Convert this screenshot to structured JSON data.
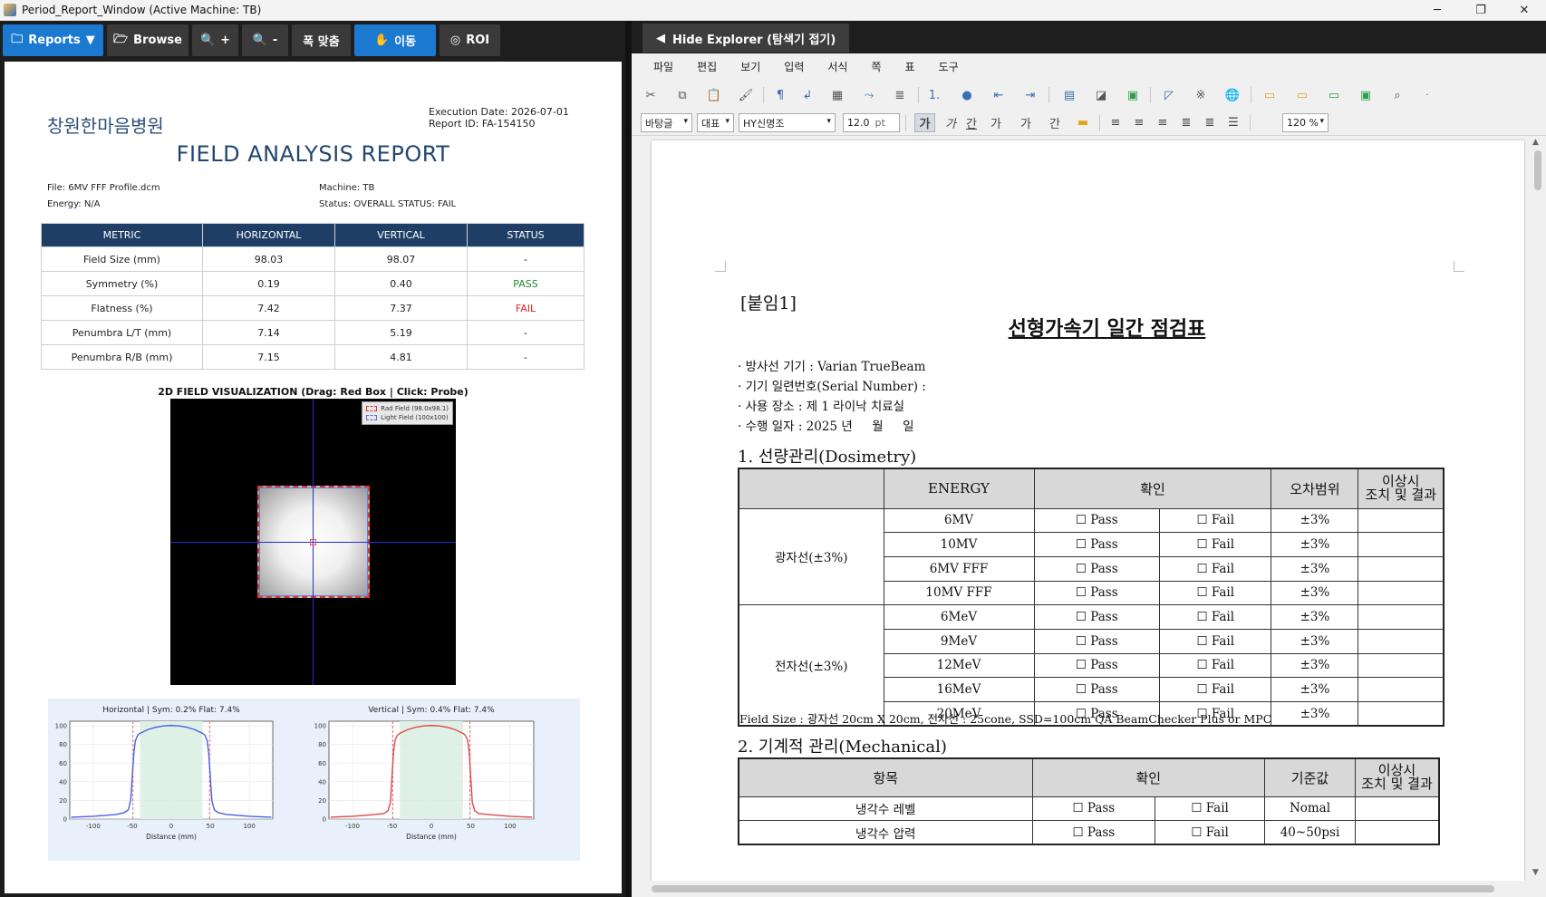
{
  "window": {
    "title": "Period_Report_Window (Active Machine: TB)",
    "minimize": "─",
    "maximize": "❐",
    "close": "✕"
  },
  "left_toolbar": {
    "reports": "Reports",
    "browse": "Browse",
    "zoom_in": "+",
    "zoom_out": "-",
    "fit_width": "폭 맞춤",
    "move": "이동",
    "roi": "ROI"
  },
  "report": {
    "hospital": "창원한마음병원",
    "execution_date": "Execution Date: 2026-07-01",
    "report_id": "Report ID: FA-154150",
    "title": "FIELD ANALYSIS REPORT",
    "file": "File: 6MV FFF Profile.dcm",
    "energy": "Energy: N/A",
    "machine": "Machine: TB",
    "status": "Status: OVERALL STATUS: FAIL",
    "table": {
      "headers": [
        "METRIC",
        "HORIZONTAL",
        "VERTICAL",
        "STATUS"
      ],
      "rows": [
        [
          "Field Size (mm)",
          "98.03",
          "98.07",
          "-"
        ],
        [
          "Symmetry (%)",
          "0.19",
          "0.40",
          "PASS"
        ],
        [
          "Flatness (%)",
          "7.42",
          "7.37",
          "FAIL"
        ],
        [
          "Penumbra L/T (mm)",
          "7.14",
          "5.19",
          "-"
        ],
        [
          "Penumbra R/B (mm)",
          "7.15",
          "4.81",
          "-"
        ]
      ]
    },
    "viz_title": "2D FIELD VISUALIZATION (Drag: Red Box | Click: Probe)",
    "viz_legend": [
      "Rad Field (98.0x98.1)",
      "Light Field (100x100)"
    ],
    "colors": {
      "header": "#1f3e66",
      "pass": "#1d8a2f",
      "fail": "#e02121",
      "horizontal": "#4a5ee8",
      "vertical": "#e04848"
    }
  },
  "chart_data": [
    {
      "type": "line",
      "title": "Horizontal | Sym: 0.2% Flat: 7.4%",
      "xlabel": "Distance (mm)",
      "ylabel": "",
      "xlim": [
        -130,
        130
      ],
      "ylim": [
        0,
        105
      ],
      "xticks": [
        -100,
        -50,
        0,
        50,
        100
      ],
      "yticks": [
        0,
        20,
        40,
        60,
        80,
        100
      ],
      "field_edges": [
        -49,
        49
      ],
      "flat_region": [
        -40,
        40
      ],
      "x": [
        -128,
        -100,
        -70,
        -60,
        -55,
        -52,
        -50,
        -48,
        -46,
        -43,
        -40,
        -30,
        -20,
        -10,
        0,
        10,
        20,
        30,
        40,
        43,
        46,
        48,
        50,
        52,
        55,
        60,
        70,
        100,
        128
      ],
      "y": [
        2,
        3,
        5,
        7,
        10,
        20,
        45,
        70,
        84,
        90,
        92,
        96,
        98.5,
        100,
        100.5,
        100,
        98.5,
        96,
        92,
        90,
        84,
        70,
        45,
        20,
        10,
        7,
        5,
        3,
        2
      ]
    },
    {
      "type": "line",
      "title": "Vertical | Sym: 0.4% Flat: 7.4%",
      "xlabel": "Distance (mm)",
      "ylabel": "",
      "xlim": [
        -130,
        130
      ],
      "ylim": [
        0,
        105
      ],
      "xticks": [
        -100,
        -50,
        0,
        50,
        100
      ],
      "yticks": [
        0,
        20,
        40,
        60,
        80,
        100
      ],
      "field_edges": [
        -49,
        49
      ],
      "flat_region": [
        -40,
        40
      ],
      "x": [
        -128,
        -100,
        -70,
        -60,
        -55,
        -52,
        -50,
        -48,
        -46,
        -43,
        -40,
        -30,
        -20,
        -10,
        0,
        10,
        20,
        30,
        40,
        43,
        46,
        48,
        50,
        52,
        55,
        60,
        70,
        100,
        128
      ],
      "y": [
        2,
        3,
        5,
        6,
        9,
        18,
        45,
        72,
        85,
        90,
        92,
        96,
        98.5,
        100,
        100.5,
        100,
        98.5,
        96,
        92,
        90,
        85,
        72,
        45,
        18,
        9,
        6,
        5,
        3,
        2
      ]
    }
  ],
  "explorer": {
    "hide_label": "Hide Explorer (탐색기 접기)",
    "arrow": "◀"
  },
  "menu": [
    "파일",
    "편집",
    "보기",
    "입력",
    "서식",
    "쪽",
    "표",
    "도구"
  ],
  "format": {
    "style": "바탕글",
    "represent": "대표",
    "font": "HY신명조",
    "size": "12.0",
    "unit": "pt",
    "zoom": "120 %",
    "buttons": [
      "가",
      "가",
      "간",
      "가",
      "가",
      "간"
    ]
  },
  "document": {
    "attachment": "[붙임1]",
    "title": "선형가속기 일간 점검표",
    "info": [
      "· 방사선 기기 : Varian TrueBeam",
      "· 기기 일련번호(Serial Number) :",
      "· 사용 장소 : 제 1 라이낙 치료실",
      "· 수행 일자 : 2025 년     월     일"
    ],
    "section1": "1. 선량관리(Dosimetry)",
    "dosimetry": {
      "headers": [
        "ENERGY",
        "확인",
        "오차범위",
        "이상시\n조치 및 결과"
      ],
      "photon_group": "광자선(±3%)",
      "electron_group": "전자선(±3%)",
      "photon_rows": [
        "6MV",
        "10MV",
        "6MV FFF",
        "10MV FFF"
      ],
      "electron_rows": [
        "6MeV",
        "9MeV",
        "12MeV",
        "16MeV",
        "20MeV"
      ],
      "pass": "☐ Pass",
      "fail": "☐ Fail",
      "tolerance": "±3%"
    },
    "note": "Field Size : 광자선 20cm X 20cm,  전자선 : 25cone, SSD=100cm     QA BeamChecker Plus or MPC",
    "section2": "2. 기계적 관리(Mechanical)",
    "mechanical": {
      "headers": [
        "항목",
        "확인",
        "기준값",
        "이상시\n조치 및 결과"
      ],
      "rows": [
        {
          "item": "냉각수 레벨",
          "value": "Nomal"
        },
        {
          "item": "냉각수 압력",
          "value": "40~50psi"
        }
      ]
    }
  }
}
